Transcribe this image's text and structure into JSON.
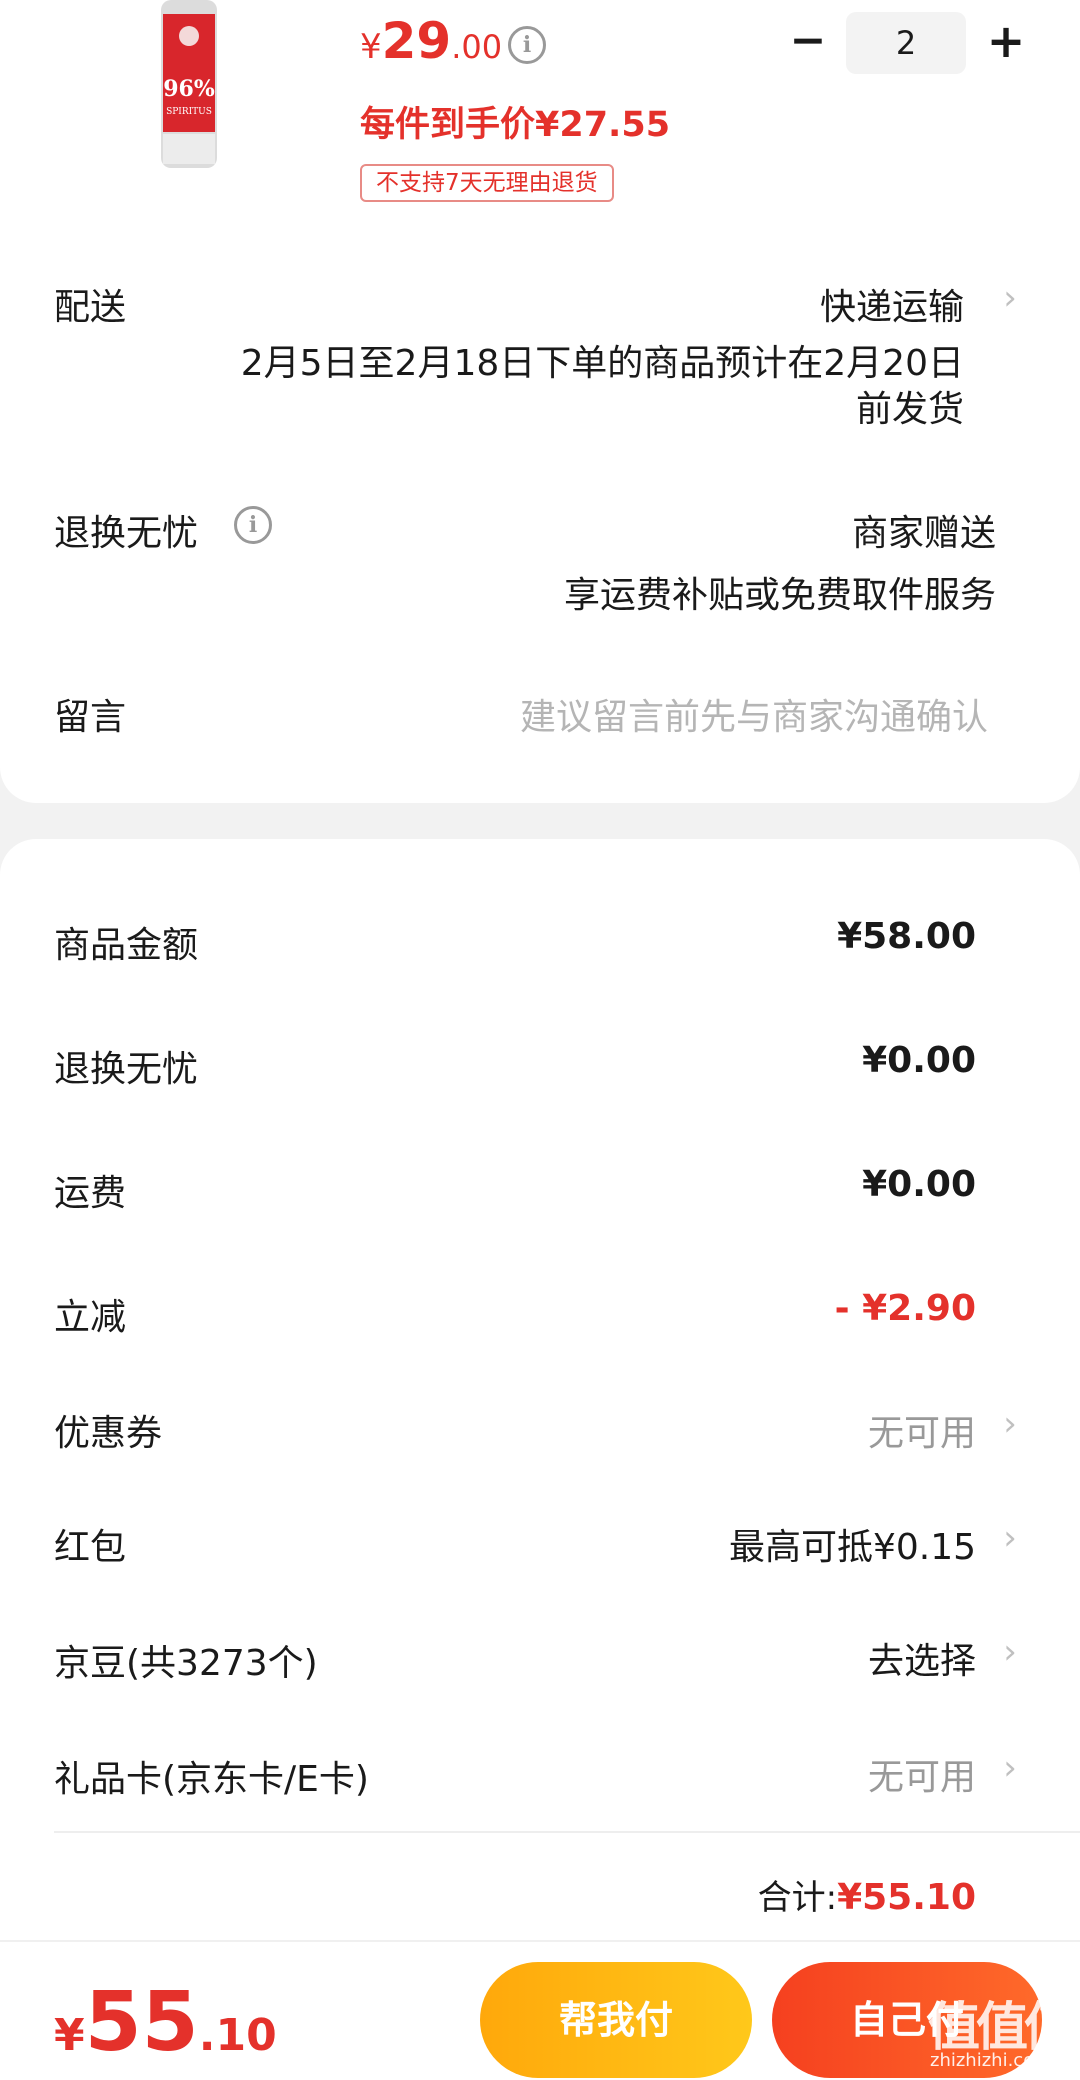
{
  "product": {
    "bottle_label_percent": "96%",
    "bottle_label_name": "SPIRITUS",
    "price_currency": "¥",
    "price_int": "29",
    "price_dec": ".00",
    "info_glyph": "i",
    "per_item_price": "每件到手价¥27.55",
    "return_tag": "不支持7天无理由退货",
    "quantity": "2",
    "minus_glyph": "−",
    "plus_glyph": "+"
  },
  "delivery": {
    "label": "配送",
    "method": "快递运输",
    "note_line1": "2月5日至2月18日下单的商品预计在2月20日",
    "note_line2": "前发货"
  },
  "return_service": {
    "label": "退换无忧",
    "value": "商家赠送",
    "sub": "享运费补贴或免费取件服务"
  },
  "message": {
    "label": "留言",
    "placeholder": "建议留言前先与商家沟通确认"
  },
  "summary": {
    "rows": [
      {
        "label": "商品金额",
        "value": "¥58.00"
      },
      {
        "label": "退换无忧",
        "value": "¥0.00"
      },
      {
        "label": "运费",
        "value": "¥0.00"
      },
      {
        "label": "立减",
        "value": "- ¥2.90"
      },
      {
        "label": "优惠券",
        "value": "无可用"
      },
      {
        "label": "红包",
        "value": "最高可抵¥0.15"
      },
      {
        "label": "京豆(共3273个)",
        "value": "去选择"
      },
      {
        "label": "礼品卡(京东卡/E卡)",
        "value": "无可用"
      }
    ],
    "total_label": "合计:",
    "total_value": "¥55.10"
  },
  "bottom": {
    "currency": "¥",
    "int": "55",
    "dec": ".10",
    "help_pay": "帮我付",
    "self_pay": "自己付",
    "watermark": "值值值",
    "watermark_site": "zhizhizhi.com"
  },
  "colors": {
    "accent_red": "#e4312b",
    "help_button": "#ffb80f",
    "self_button": "#f5401f"
  },
  "icons": [
    "info-icon",
    "chevron-right-icon",
    "minus-icon",
    "plus-icon"
  ]
}
